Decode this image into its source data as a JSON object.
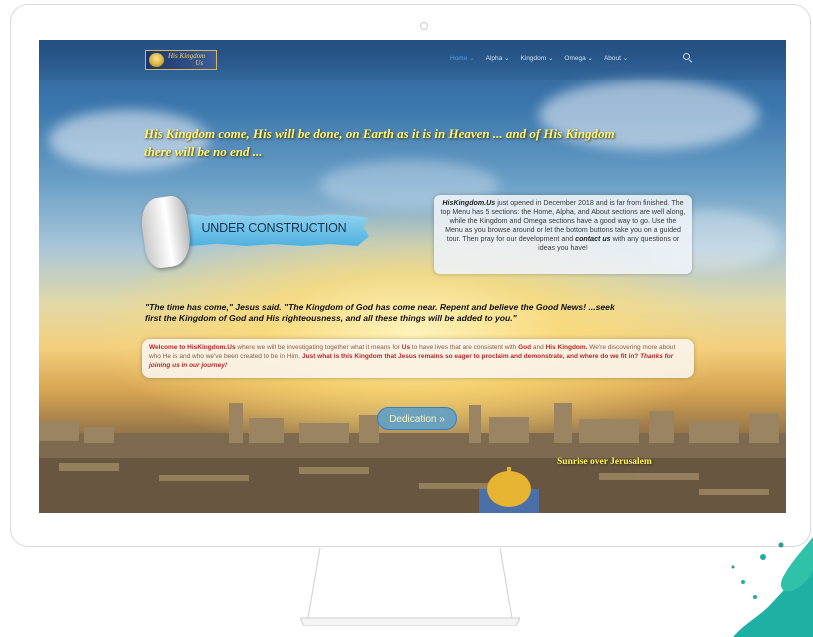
{
  "site": {
    "logo_text_line1": "His Kingdom",
    "logo_text_line2": "Us"
  },
  "nav": {
    "items": [
      {
        "label": "Home ⌄",
        "active": true
      },
      {
        "label": "Alpha ⌄",
        "active": false
      },
      {
        "label": "Kingdom ⌄",
        "active": false
      },
      {
        "label": "Omega ⌄",
        "active": false
      },
      {
        "label": "About ⌄",
        "active": false
      }
    ],
    "search_icon": "search-icon",
    "active_color": "#4aa0ef"
  },
  "hero": {
    "headline_line1": "His Kingdom come, His will be done, on Earth as it is in Heaven ... and of His Kingdom",
    "headline_line2": "there will be no end ..."
  },
  "banner": {
    "label": "UNDER CONSTRUCTION"
  },
  "info": {
    "site_name": "HisKingdom.Us",
    "text_a": " just opened in December 2018 and is far from finished. The top Menu has 5 sections: the Home, Alpha, and About sections are well along, while the Kingdom and Omega sections have a good way to go. Use the Menu as you browse around or let the bottom buttons take you on a guided tour. Then pray for our development and ",
    "contact": "contact us",
    "text_b": " with any questions or ideas you have!"
  },
  "quote": {
    "line1": "\"The time has come,\" Jesus said. \"The Kingdom of God has come near. Repent and believe the Good News! ...seek",
    "line2": "first the Kingdom of God and His righteousness, and all these things will be added to you.\""
  },
  "welcome": {
    "part1": "Welcome to HisKingdom.Us",
    "part2": " where we will be investigating together what it means for ",
    "part3": "Us",
    "part4": " to have lives that are consistent with ",
    "part5": "God",
    "part6": " and ",
    "part7": "His Kingdom.",
    "part8": " We're discovering more about who He is and who we've been created to be in Him. ",
    "part9": "Just what is this Kingdom that Jesus remains so eager to proclaim and demonstrate, and where do we fit in?",
    "part10": " ",
    "part11": "Thanks for joining us in our journey!"
  },
  "button": {
    "dedication": "Dedication »"
  },
  "caption": {
    "sunrise": "Sunrise over Jerusalem"
  },
  "colors": {
    "headline": "#fff37a",
    "button_bg": "#60a0c8",
    "accent_red": "#b8282b"
  }
}
